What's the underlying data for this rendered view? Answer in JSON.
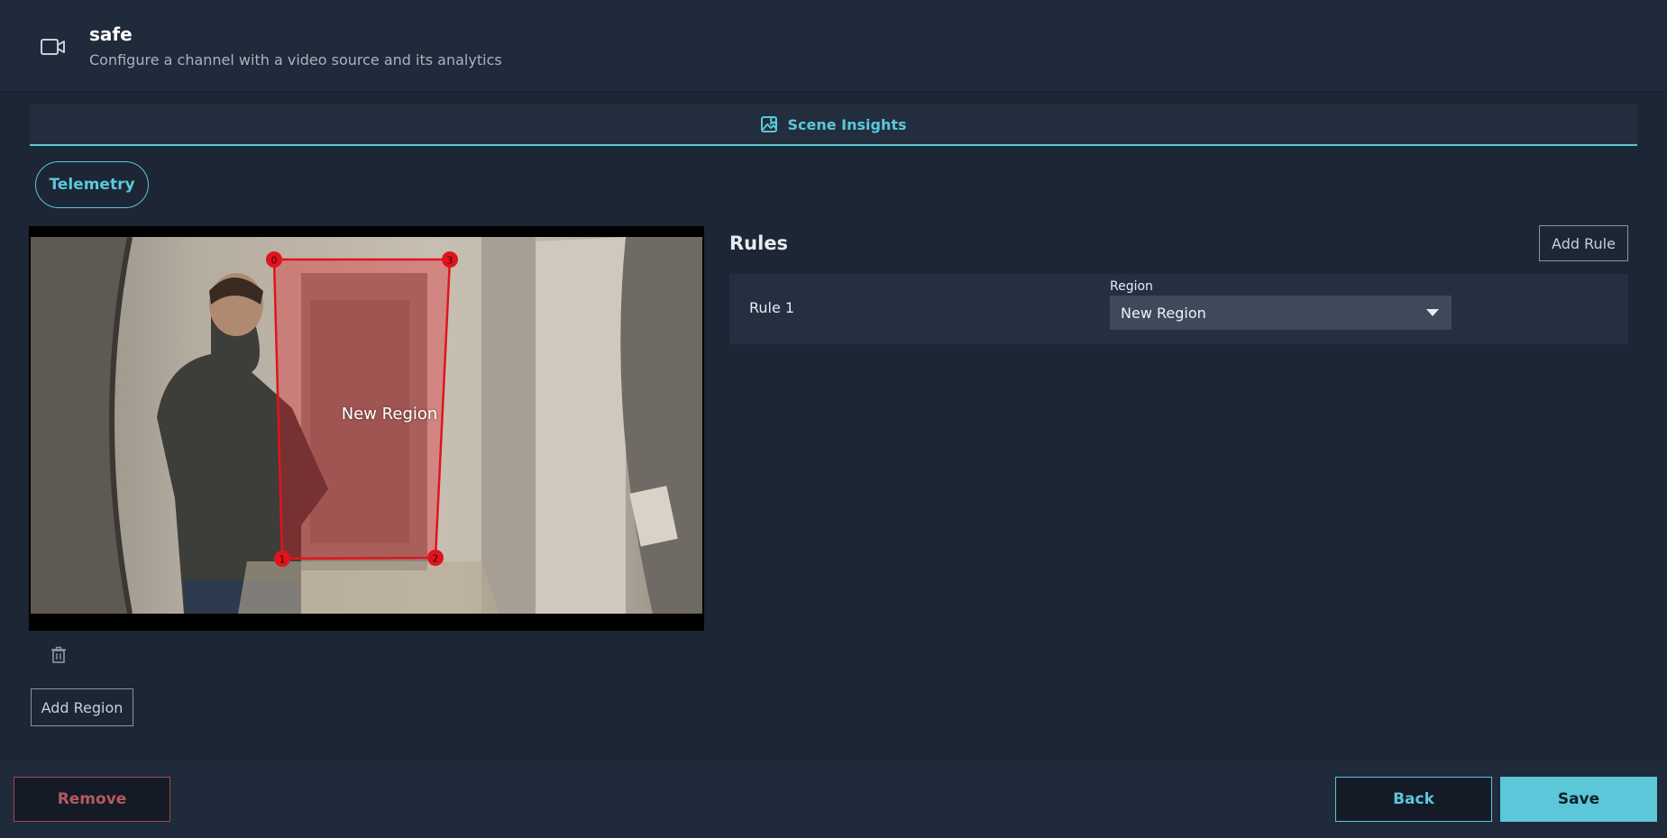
{
  "header": {
    "title": "safe",
    "subtitle": "Configure a channel with a video source and its analytics",
    "icon": "video-camera-icon"
  },
  "tabs": [
    {
      "label": "Scene Insights",
      "icon": "image-person-icon",
      "active": true
    }
  ],
  "telemetry": {
    "label": "Telemetry"
  },
  "video": {
    "region": {
      "label": "New Region",
      "color": "#e0141e",
      "vertex_labels": [
        "0",
        "1",
        "2",
        "3"
      ]
    }
  },
  "region_controls": {
    "delete_icon": "trash-icon",
    "add_region_label": "Add Region"
  },
  "rules": {
    "title": "Rules",
    "add_rule_label": "Add Rule",
    "items": [
      {
        "name": "Rule 1",
        "region_label": "Region",
        "region_value": "New Region"
      }
    ]
  },
  "footer": {
    "remove_label": "Remove",
    "back_label": "Back",
    "save_label": "Save"
  },
  "colors": {
    "accent": "#5bc7d9",
    "danger": "#b35a62",
    "background": "#1c2634"
  }
}
